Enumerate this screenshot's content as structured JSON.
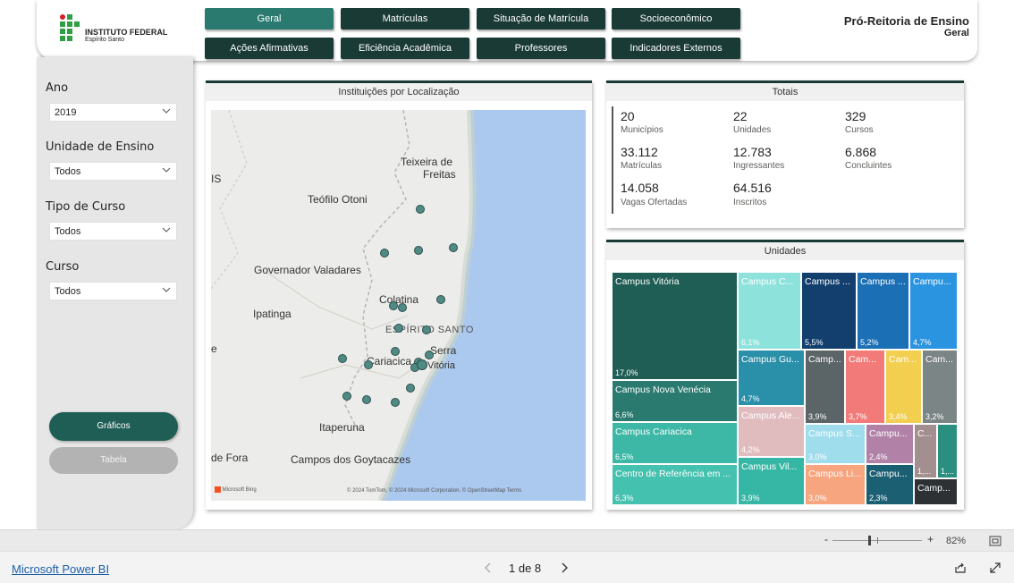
{
  "header": {
    "logo_name": "INSTITUTO FEDERAL",
    "logo_sub": "Espírito Santo",
    "title": "Pró-Reitoria de Ensino",
    "subtitle": "Geral",
    "nav": [
      {
        "label": "Geral",
        "active": true
      },
      {
        "label": "Matrículas",
        "active": false
      },
      {
        "label": "Situação de Matrícula",
        "active": false
      },
      {
        "label": "Socioeconômico",
        "active": false
      },
      {
        "label": "Ações Afirmativas",
        "active": false
      },
      {
        "label": "Eficiência Acadêmica",
        "active": false
      },
      {
        "label": "Professores",
        "active": false
      },
      {
        "label": "Indicadores Externos",
        "active": false
      }
    ]
  },
  "filters": [
    {
      "label": "Ano",
      "value": "2019"
    },
    {
      "label": "Unidade de Ensino",
      "value": "Todos"
    },
    {
      "label": "Tipo de Curso",
      "value": "Todos"
    },
    {
      "label": "Curso",
      "value": "Todos"
    }
  ],
  "sidebar_buttons": {
    "graficos": "Gráficos",
    "tabela": "Tabela"
  },
  "map_card": {
    "title": "Instituições por Localização",
    "place_labels": [
      "Teixeira de",
      "Freitas",
      "Teófilo Otoni",
      "Governador Valadares",
      "Ipatinga",
      "Colatina",
      "ESPÍRITO SANTO",
      "Serra",
      "Cariacica",
      "Vitória",
      "Itaperuna",
      "de Fora",
      "Campos dos Goytacazes",
      "IS",
      "e"
    ],
    "attribution": "© 2024 TomTom, © 2024 Microsoft Corporation, © OpenStreetMap  Terms",
    "bing_logo": "Microsoft Bing"
  },
  "totals": {
    "title": "Totais",
    "items": [
      {
        "value": "20",
        "label": "Municípios"
      },
      {
        "value": "22",
        "label": "Unidades"
      },
      {
        "value": "329",
        "label": "Cursos"
      },
      {
        "value": "33.112",
        "label": "Matrículas"
      },
      {
        "value": "12.783",
        "label": "Ingressantes"
      },
      {
        "value": "6.868",
        "label": "Concluintes"
      },
      {
        "value": "14.058",
        "label": "Vagas Ofertadas"
      },
      {
        "value": "64.516",
        "label": "Inscritos"
      }
    ]
  },
  "units": {
    "title": "Unidades",
    "tiles": [
      {
        "name": "Campus Vitória",
        "pct": "17,0%",
        "color": "#1f5e55"
      },
      {
        "name": "Campus Nova Venécia",
        "pct": "6,6%",
        "color": "#2a7a70"
      },
      {
        "name": "Campus Cariacica",
        "pct": "6,5%",
        "color": "#3db8a6"
      },
      {
        "name": "Centro de Referência em ...",
        "pct": "6,3%",
        "color": "#45c1b0"
      },
      {
        "name": "Campus C...",
        "pct": "6,1%",
        "color": "#8ee2dc"
      },
      {
        "name": "Campus ...",
        "pct": "5,5%",
        "color": "#123f6e"
      },
      {
        "name": "Campus ...",
        "pct": "5,2%",
        "color": "#1b6fb5"
      },
      {
        "name": "Campu...",
        "pct": "4,7%",
        "color": "#2b94e0"
      },
      {
        "name": "Campus Gu...",
        "pct": "4,7%",
        "color": "#2a8fa8"
      },
      {
        "name": "Camp...",
        "pct": "3,9%",
        "color": "#5b6467"
      },
      {
        "name": "Cam...",
        "pct": "3,7%",
        "color": "#f27b7a"
      },
      {
        "name": "Cam...",
        "pct": "3,4%",
        "color": "#f2cf4f"
      },
      {
        "name": "Cam...",
        "pct": "3,2%",
        "color": "#7b8585"
      },
      {
        "name": "Campus Ale...",
        "pct": "4,2%",
        "color": "#e1bcbf"
      },
      {
        "name": "Campus S...",
        "pct": "3,0%",
        "color": "#9fdcec"
      },
      {
        "name": "Campu...",
        "pct": "2,4%",
        "color": "#b281a8"
      },
      {
        "name": "C...",
        "pct": "1,...",
        "color": "#a38f8f"
      },
      {
        "name": "",
        "pct": "1,...",
        "color": "#2a8f7e"
      },
      {
        "name": "Campus Vil...",
        "pct": "3,9%",
        "color": "#36b6a4"
      },
      {
        "name": "Campus Li...",
        "pct": "3,0%",
        "color": "#f6a57f"
      },
      {
        "name": "Campu...",
        "pct": "2,3%",
        "color": "#1b5f73"
      },
      {
        "name": "Camp...",
        "pct": "",
        "color": "#2d3134"
      }
    ]
  },
  "footer": {
    "brand": "Microsoft Power BI",
    "page": "1 de 8",
    "zoom_minus": "-",
    "zoom_plus": "+",
    "zoom": "82%",
    "zoom_level": 0.82
  }
}
